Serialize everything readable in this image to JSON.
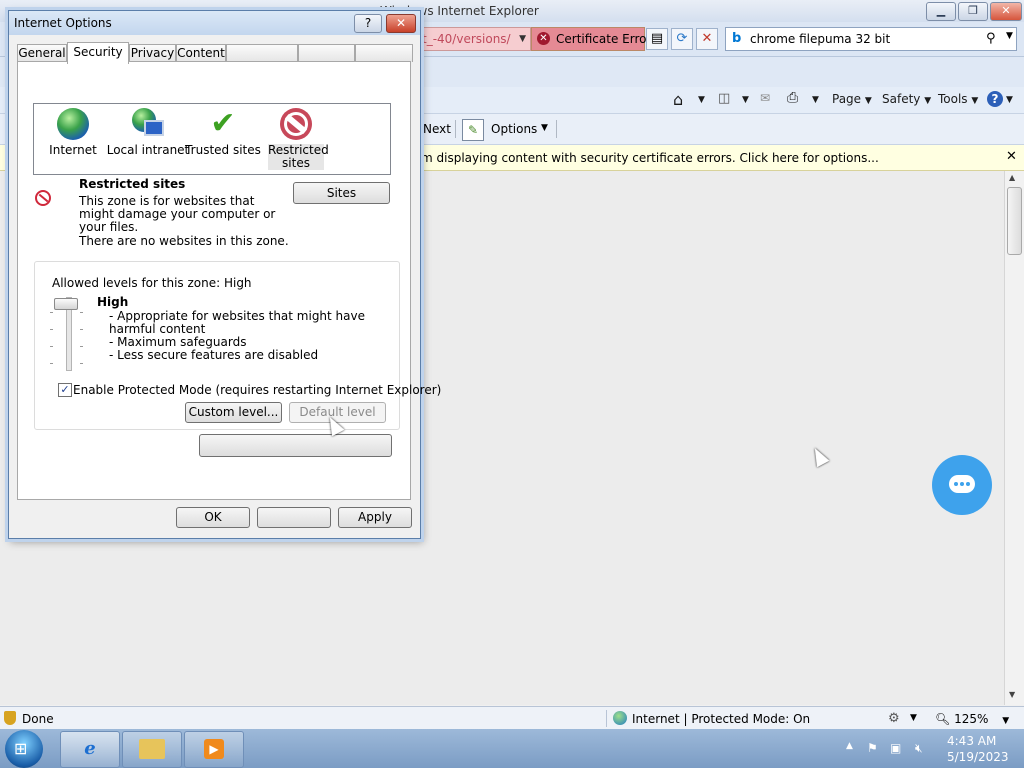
{
  "ie": {
    "window_title": "Windows Internet Explorer",
    "address_tail": "t_-40/versions/",
    "cert_error": "Certificate Error",
    "search_text": "chrome filepuma 32 bit",
    "cmd": {
      "page": "Page",
      "safety": "Safety",
      "tools": "Tools"
    },
    "find": {
      "next": "Next",
      "options": "Options"
    },
    "infobar": "m displaying content with security certificate errors. Click here for options...",
    "status": {
      "left": "Done",
      "zone": "Internet | Protected Mode: On",
      "zoom": "125%"
    }
  },
  "taskbar": {
    "time": "4:43 AM",
    "date": "5/19/2023"
  },
  "dialog": {
    "title": "Internet Options",
    "help_label": "?",
    "tabs": [
      "General",
      "Security",
      "Privacy",
      "Content",
      "",
      "",
      ""
    ],
    "active_tab": "Security",
    "zones": [
      {
        "label": "Internet",
        "icon": "globe-icon"
      },
      {
        "label": "Local intranet",
        "icon": "intranet-icon"
      },
      {
        "label": "Trusted sites",
        "icon": "checkmark-icon"
      },
      {
        "label": "Restricted sites",
        "icon": "restricted-icon",
        "selected": true
      }
    ],
    "zone_title": "Restricted sites",
    "zone_description": "This zone is for websites that might damage your computer or your files.",
    "zone_no_sites": "There are no websites in this zone.",
    "sites_button": "Sites",
    "levels_caption": "Allowed levels for this zone: High",
    "level_name": "High",
    "level_details": [
      "- Appropriate for websites that might have harmful content",
      "- Maximum safeguards",
      "- Less secure features are disabled"
    ],
    "slider_level_fraction": 1.0,
    "protected_mode_label": "Enable Protected Mode (requires restarting Internet Explorer)",
    "protected_mode_checked": true,
    "custom_level_button": "Custom level...",
    "default_level_button": "Default level",
    "reset_all_button": "",
    "ok_button": "OK",
    "cancel_button": "",
    "apply_button": "Apply"
  },
  "colors": {
    "infobar_bg": "#ffffe1",
    "cert_error_bg": "#e58a94",
    "chat_fab": "#3ea2ec"
  }
}
